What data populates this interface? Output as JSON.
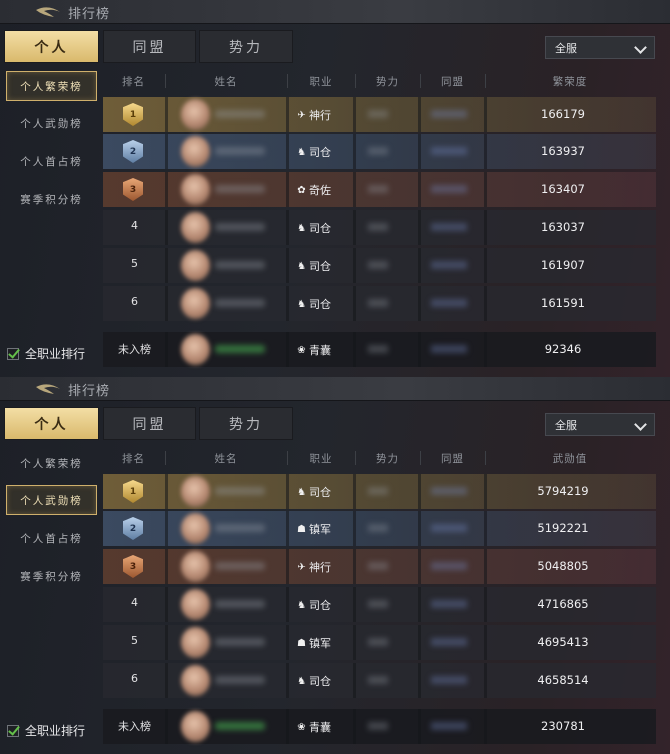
{
  "panels": [
    {
      "title": "排行榜",
      "tabs": [
        "个人",
        "同盟",
        "势力"
      ],
      "active_tab": 0,
      "server_select": "全服",
      "sidebar": [
        "个人繁荣榜",
        "个人武勋榜",
        "个人首占榜",
        "赛季积分榜"
      ],
      "active_sidebar": 0,
      "columns": [
        "排名",
        "姓名",
        "职业",
        "势力",
        "同盟",
        "繁荣度"
      ],
      "rows": [
        {
          "rank": "1",
          "medal": "gold",
          "job_icon": "bird-icon",
          "job": "神行",
          "value": "166179"
        },
        {
          "rank": "2",
          "medal": "silver",
          "job_icon": "horse-icon",
          "job": "司仓",
          "value": "163937"
        },
        {
          "rank": "3",
          "medal": "bronze",
          "job_icon": "fan-icon",
          "job": "奇佐",
          "value": "163407"
        },
        {
          "rank": "4",
          "medal": "",
          "job_icon": "horse-icon",
          "job": "司仓",
          "value": "163037"
        },
        {
          "rank": "5",
          "medal": "",
          "job_icon": "horse-icon",
          "job": "司仓",
          "value": "161907"
        },
        {
          "rank": "6",
          "medal": "",
          "job_icon": "horse-icon",
          "job": "司仓",
          "value": "161591"
        }
      ],
      "self_row": {
        "rank": "未入榜",
        "job_icon": "lotus-icon",
        "job": "青囊",
        "value": "92346"
      },
      "checkbox_label": "全职业排行"
    },
    {
      "title": "排行榜",
      "tabs": [
        "个人",
        "同盟",
        "势力"
      ],
      "active_tab": 0,
      "server_select": "全服",
      "sidebar": [
        "个人繁荣榜",
        "个人武勋榜",
        "个人首占榜",
        "赛季积分榜"
      ],
      "active_sidebar": 1,
      "columns": [
        "排名",
        "姓名",
        "职业",
        "势力",
        "同盟",
        "武勋值"
      ],
      "rows": [
        {
          "rank": "1",
          "medal": "gold",
          "job_icon": "horse-icon",
          "job": "司仓",
          "value": "5794219"
        },
        {
          "rank": "2",
          "medal": "silver",
          "job_icon": "mask-icon",
          "job": "镇军",
          "value": "5192221"
        },
        {
          "rank": "3",
          "medal": "bronze",
          "job_icon": "bird-icon",
          "job": "神行",
          "value": "5048805"
        },
        {
          "rank": "4",
          "medal": "",
          "job_icon": "horse-icon",
          "job": "司仓",
          "value": "4716865"
        },
        {
          "rank": "5",
          "medal": "",
          "job_icon": "mask-icon",
          "job": "镇军",
          "value": "4695413"
        },
        {
          "rank": "6",
          "medal": "",
          "job_icon": "horse-icon",
          "job": "司仓",
          "value": "4658514"
        }
      ],
      "self_row": {
        "rank": "未入榜",
        "job_icon": "lotus-icon",
        "job": "青囊",
        "value": "230781"
      },
      "checkbox_label": "全职业排行"
    }
  ],
  "colors": {
    "gold_tab": "#e6c980",
    "checkbox_green": "#64c04a"
  }
}
